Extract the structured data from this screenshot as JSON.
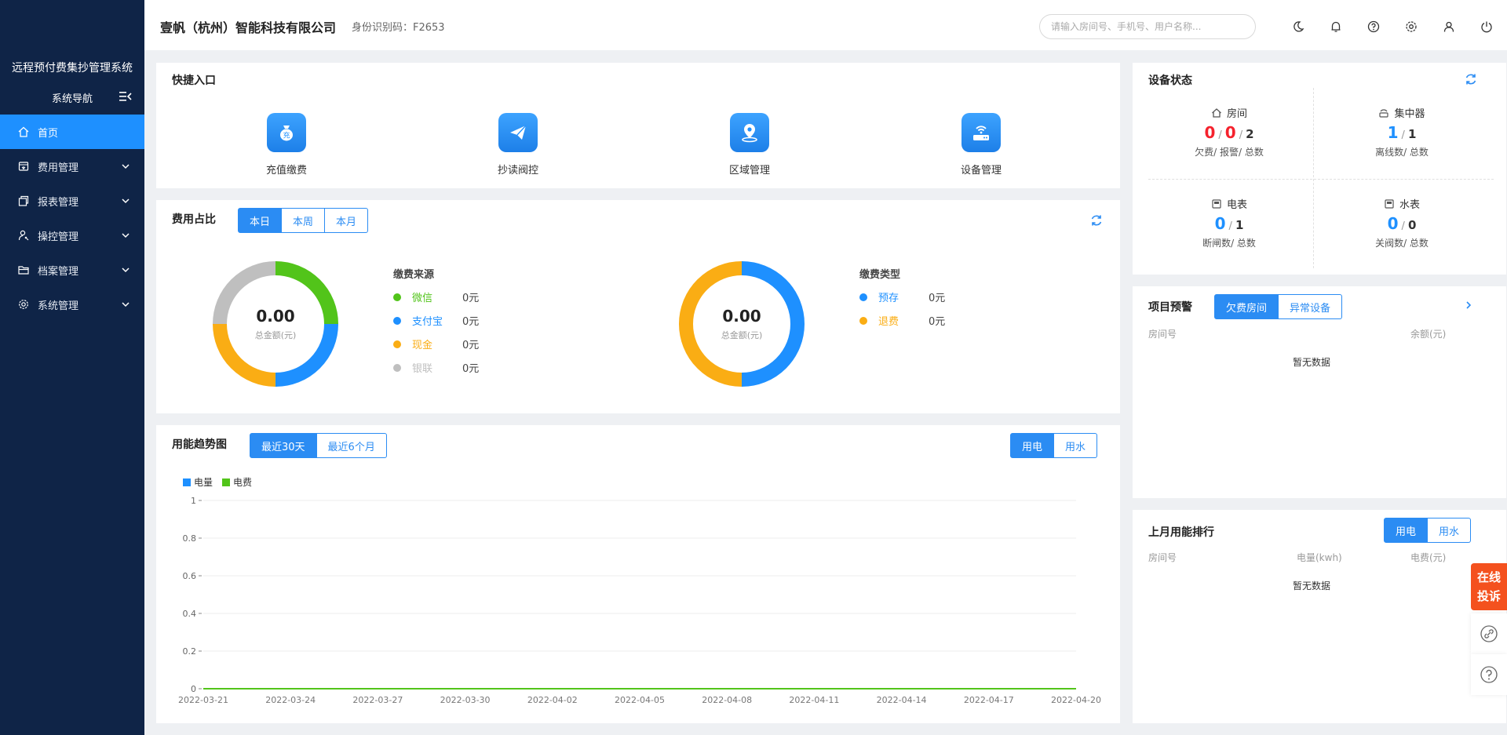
{
  "sidebar": {
    "title": "远程预付费集抄管理系统",
    "nav_label": "系统导航",
    "items": [
      {
        "label": "首页",
        "icon": "home-icon",
        "active": true
      },
      {
        "label": "费用管理",
        "icon": "fee-icon"
      },
      {
        "label": "报表管理",
        "icon": "report-icon"
      },
      {
        "label": "操控管理",
        "icon": "control-icon"
      },
      {
        "label": "档案管理",
        "icon": "folder-icon"
      },
      {
        "label": "系统管理",
        "icon": "gear-icon"
      }
    ]
  },
  "header": {
    "company": "壹帆（杭州）智能科技有限公司",
    "ident": "身份识别码：F2653",
    "search_placeholder": "请输入房间号、手机号、用户名称...",
    "icons": [
      "moon-icon",
      "bell-icon",
      "help-icon",
      "settings-icon",
      "user-icon",
      "power-icon"
    ]
  },
  "quick": {
    "title": "快捷入口",
    "items": [
      {
        "label": "充值缴费",
        "icon": "money-bag-icon"
      },
      {
        "label": "抄读阀控",
        "icon": "paper-plane-icon"
      },
      {
        "label": "区域管理",
        "icon": "location-icon"
      },
      {
        "label": "设备管理",
        "icon": "router-icon"
      }
    ]
  },
  "fee": {
    "title": "费用占比",
    "tabs": [
      "本日",
      "本周",
      "本月"
    ],
    "active_tab": 0,
    "donut1": {
      "value": "0.00",
      "sub": "总金额(元)",
      "legend_title": "缴费来源",
      "items": [
        {
          "name": "微信",
          "value": "0元",
          "color": "#52c41a"
        },
        {
          "name": "支付宝",
          "value": "0元",
          "color": "#1e90ff"
        },
        {
          "name": "现金",
          "value": "0元",
          "color": "#faad14"
        },
        {
          "name": "银联",
          "value": "0元",
          "color": "#bfbfbf"
        }
      ]
    },
    "donut2": {
      "value": "0.00",
      "sub": "总金额(元)",
      "legend_title": "缴费类型",
      "items": [
        {
          "name": "预存",
          "value": "0元",
          "color": "#1e90ff"
        },
        {
          "name": "退费",
          "value": "0元",
          "color": "#faad14"
        }
      ]
    }
  },
  "trend": {
    "title": "用能趋势图",
    "range_tabs": [
      "最近30天",
      "最近6个月"
    ],
    "type_tabs": [
      "用电",
      "用水"
    ]
  },
  "chart_data": {
    "type": "line",
    "series": [
      {
        "name": "电量",
        "color": "#1e90ff",
        "values": [
          0,
          0,
          0,
          0,
          0,
          0,
          0,
          0,
          0,
          0,
          0,
          0,
          0,
          0,
          0,
          0,
          0,
          0,
          0,
          0,
          0,
          0,
          0,
          0,
          0,
          0,
          0,
          0,
          0,
          0,
          0
        ]
      },
      {
        "name": "电费",
        "color": "#52c41a",
        "values": [
          0,
          0,
          0,
          0,
          0,
          0,
          0,
          0,
          0,
          0,
          0,
          0,
          0,
          0,
          0,
          0,
          0,
          0,
          0,
          0,
          0,
          0,
          0,
          0,
          0,
          0,
          0,
          0,
          0,
          0,
          0
        ]
      }
    ],
    "x": [
      "2022-03-21",
      "2022-03-22",
      "2022-03-23",
      "2022-03-24",
      "2022-03-25",
      "2022-03-26",
      "2022-03-27",
      "2022-03-28",
      "2022-03-29",
      "2022-03-30",
      "2022-03-31",
      "2022-04-01",
      "2022-04-02",
      "2022-04-03",
      "2022-04-04",
      "2022-04-05",
      "2022-04-06",
      "2022-04-07",
      "2022-04-08",
      "2022-04-09",
      "2022-04-10",
      "2022-04-11",
      "2022-04-12",
      "2022-04-13",
      "2022-04-14",
      "2022-04-15",
      "2022-04-16",
      "2022-04-17",
      "2022-04-18",
      "2022-04-19",
      "2022-04-20"
    ],
    "x_ticks": [
      "2022-03-21",
      "2022-03-24",
      "2022-03-27",
      "2022-03-30",
      "2022-04-02",
      "2022-04-05",
      "2022-04-08",
      "2022-04-11",
      "2022-04-14",
      "2022-04-17",
      "2022-04-20"
    ],
    "y_ticks": [
      "1",
      "0.8",
      "0.6",
      "0.4",
      "0.2",
      "0"
    ],
    "ylim": [
      0,
      1
    ],
    "grid": true,
    "legend": "top-left"
  },
  "device": {
    "title": "设备状态",
    "cells": [
      {
        "name": "房间",
        "icon": "house-icon",
        "a": "0",
        "b": "0",
        "total": "2",
        "desc": "欠费/ 报警/ 总数"
      },
      {
        "name": "集中器",
        "icon": "concentrator-icon",
        "a": "1",
        "total": "1",
        "desc": "离线数/ 总数"
      },
      {
        "name": "电表",
        "icon": "meter-icon",
        "a": "0",
        "total": "1",
        "desc": "断闸数/ 总数"
      },
      {
        "name": "水表",
        "icon": "water-meter-icon",
        "a": "0",
        "total": "0",
        "desc": "关阀数/ 总数"
      }
    ],
    "colors": {
      "red": "#f5222d",
      "blue": "#1e90ff"
    }
  },
  "warning": {
    "title": "项目预警",
    "tabs": [
      "欠费房间",
      "异常设备"
    ],
    "col_room": "房间号",
    "col_balance": "余额(元)",
    "empty": "暂无数据"
  },
  "ranking": {
    "title": "上月用能排行",
    "tabs": [
      "用电",
      "用水"
    ],
    "col_room": "房间号",
    "col_kwh": "电量(kwh)",
    "col_fee": "电费(元)",
    "empty": "暂无数据"
  },
  "float": {
    "complaint_line1": "在线",
    "complaint_line2": "投诉"
  }
}
